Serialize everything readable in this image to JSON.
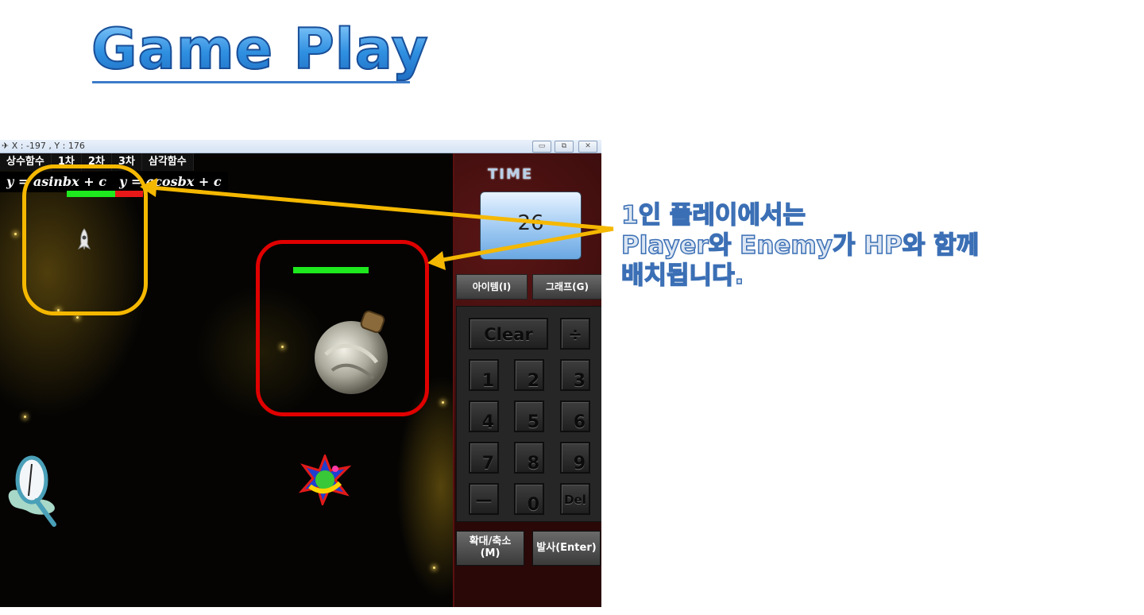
{
  "slide": {
    "title": "Game Play",
    "annotation_lines": [
      "1인 플레이에서는",
      "Player와 Enemy가 HP와 함께",
      "배치됩니다."
    ],
    "callout_colors": {
      "player": "#f5b800",
      "enemy": "#e00000",
      "arrow": "#f5b800"
    }
  },
  "window": {
    "title_coords": "X : -197 , Y : 176",
    "buttons": {
      "minimize": "▭",
      "maximize": "⧉",
      "close": "✕"
    }
  },
  "game": {
    "menu": [
      "상수함수",
      "1차",
      "2차",
      "3차",
      "삼각함수"
    ],
    "formulas": [
      "y = asinbx + c",
      "y = acosbx + c"
    ],
    "player_hp_fraction": 0.64,
    "enemy_hp_fraction": 1.0,
    "colors": {
      "hp_full": "#1ee81e",
      "hp_lost": "#e81818"
    }
  },
  "panel": {
    "time_label": "TIME",
    "time_value": "26",
    "item_button": "아이템(I)",
    "graph_button": "그래프(G)",
    "keys": {
      "clear": "Clear",
      "divide": "÷",
      "k1": "1",
      "k2": "2",
      "k3": "3",
      "k4": "4",
      "k5": "5",
      "k6": "6",
      "k7": "7",
      "k8": "8",
      "k9": "9",
      "minus": "—",
      "k0": "0",
      "del": "Del"
    },
    "zoom_button_line1": "확대/축소",
    "zoom_button_line2": "(M)",
    "fire_button": "발사(Enter)"
  }
}
